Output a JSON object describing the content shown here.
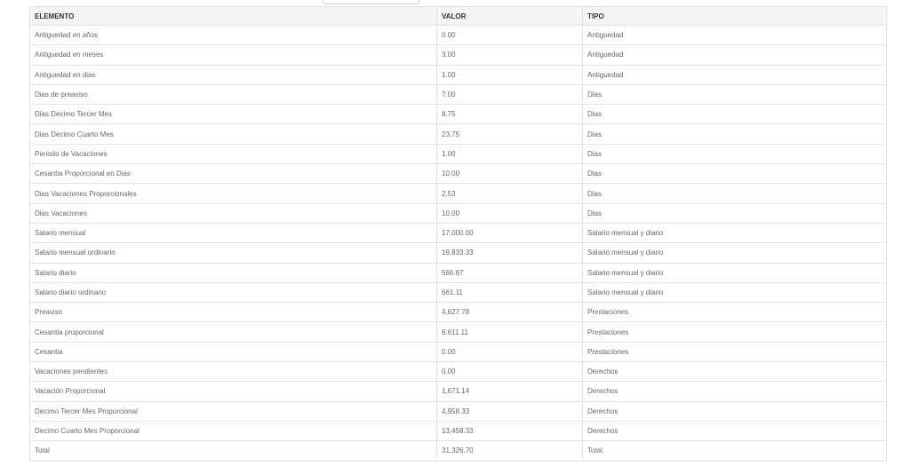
{
  "table": {
    "headers": {
      "elemento": "ELEMENTO",
      "valor": "VALOR",
      "tipo": "TIPO"
    },
    "rows": [
      {
        "elemento": "Antiguedad en años",
        "valor": "0.00",
        "tipo": "Antiguedad"
      },
      {
        "elemento": "Antiguedad en meses",
        "valor": "3.00",
        "tipo": "Antiguedad"
      },
      {
        "elemento": "Antiguedad en dias",
        "valor": "1.00",
        "tipo": "Antiguedad"
      },
      {
        "elemento": "Dias de preaviso",
        "valor": "7.00",
        "tipo": "Dias"
      },
      {
        "elemento": "Dias Decimo Tercer Mes",
        "valor": "8.75",
        "tipo": "Dias"
      },
      {
        "elemento": "Dias Decimo Cuarto Mes",
        "valor": "23.75",
        "tipo": "Dias"
      },
      {
        "elemento": "Periodo de Vacaciones",
        "valor": "1.00",
        "tipo": "Dias"
      },
      {
        "elemento": "Cesantia Proporcional en Dias",
        "valor": "10.00",
        "tipo": "Dias"
      },
      {
        "elemento": "Dias Vacaciones Proporcionales",
        "valor": "2.53",
        "tipo": "Dias"
      },
      {
        "elemento": "Dias Vacaciones",
        "valor": "10.00",
        "tipo": "Dias"
      },
      {
        "elemento": "Salario mensual",
        "valor": "17,000.00",
        "tipo": "Salario mensual y diario"
      },
      {
        "elemento": "Salario mensual ordinario",
        "valor": "19,833.33",
        "tipo": "Salario mensual y diario"
      },
      {
        "elemento": "Salario diario",
        "valor": "566.67",
        "tipo": "Salario mensual y diario"
      },
      {
        "elemento": "Salario diario ordinario",
        "valor": "661.11",
        "tipo": "Salario mensual y diario"
      },
      {
        "elemento": "Preaviso",
        "valor": "4,627.78",
        "tipo": "Prestaciones"
      },
      {
        "elemento": "Cesantia proporcional",
        "valor": "6,611.11",
        "tipo": "Prestaciones"
      },
      {
        "elemento": "Cesantia",
        "valor": "0.00",
        "tipo": "Prestaciones"
      },
      {
        "elemento": "Vacaciones pendientes",
        "valor": "0.00",
        "tipo": "Derechos"
      },
      {
        "elemento": "Vacación Proporcional",
        "valor": "1,671.14",
        "tipo": "Derechos"
      },
      {
        "elemento": "Decimo Tercer Mes Proporcional",
        "valor": "4,958.33",
        "tipo": "Derechos"
      },
      {
        "elemento": "Decimo Cuarto Mes Proporcional",
        "valor": "13,458.33",
        "tipo": "Derechos"
      },
      {
        "elemento": "Total",
        "valor": "31,326.70",
        "tipo": "Total"
      }
    ]
  }
}
